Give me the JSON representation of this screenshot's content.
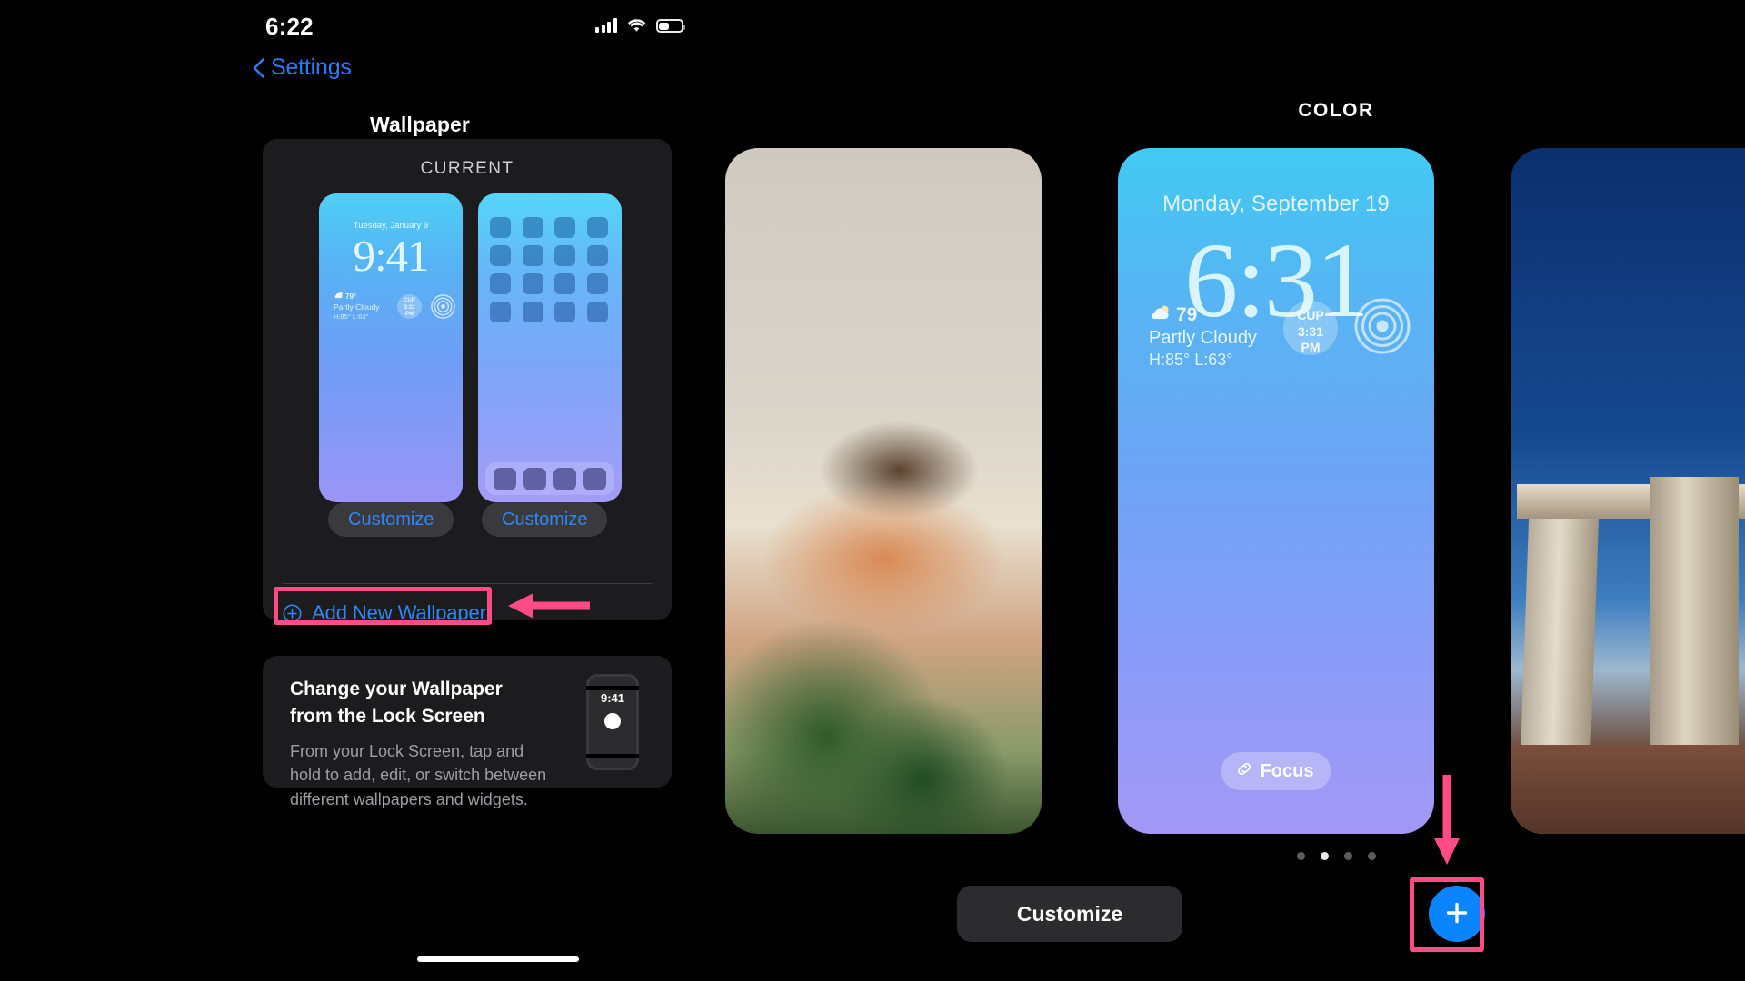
{
  "status_bar": {
    "time": "6:22",
    "icons": [
      "cellular-signal-icon",
      "wifi-icon",
      "battery-icon"
    ],
    "battery_level_pct": 45
  },
  "nav_bar": {
    "back_label": "Settings",
    "title": "Wallpaper"
  },
  "current_card": {
    "section_title": "CURRENT",
    "lock_preview": {
      "date": "Tuesday, January 9",
      "time": "9:41",
      "weather_temp": "79°",
      "weather_condition": "Partly Cloudy",
      "weather_range": "H:85° L:63°",
      "widget_location": "CUP",
      "widget_time": "3:22",
      "widget_period": "PM"
    },
    "home_preview": {
      "icon_rows": 4,
      "icon_cols": 4,
      "dock_icons": 4
    },
    "customize_lock_label": "Customize",
    "customize_home_label": "Customize",
    "add_new_label": "Add New Wallpaper",
    "add_new_icon": "plus-circle-icon"
  },
  "info_card": {
    "title": "Change your Wallpaper from the Lock Screen",
    "body": "From your Lock Screen, tap and hold to add, edit, or switch between different wallpapers and widgets.",
    "mini_phone_time": "9:41"
  },
  "gallery": {
    "section_title": "COLOR",
    "lock_preview": {
      "date": "Monday, September 19",
      "time": "6:31",
      "weather_temp": "79°",
      "weather_condition": "Partly Cloudy",
      "weather_range": "H:85° L:63°",
      "widget_location": "CUP",
      "widget_time": "3:31",
      "widget_period": "PM",
      "focus_label": "Focus",
      "focus_icon": "link-icon"
    },
    "page_dots": {
      "count": 4,
      "active_index": 1
    },
    "customize_label": "Customize",
    "add_button_icon": "plus-icon",
    "gradient_top": "#41caf2",
    "gradient_bottom": "#a498f6"
  },
  "annotations": {
    "highlight_color": "#ff4b86",
    "boxes": [
      "add-new-wallpaper-row",
      "add-wallpaper-fab"
    ],
    "arrows": [
      "arrow-pointing-left-at-add-new-wallpaper",
      "arrow-pointing-down-at-fab"
    ]
  }
}
